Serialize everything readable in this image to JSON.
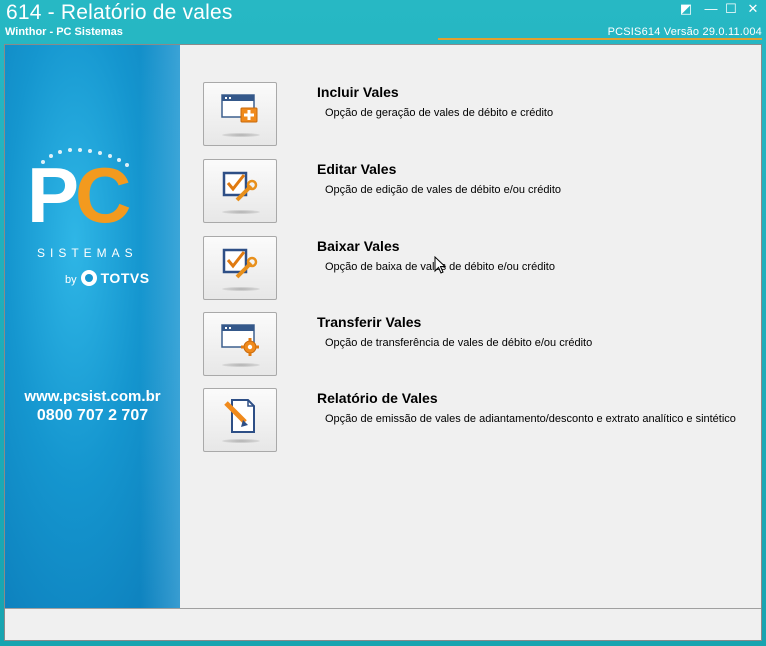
{
  "window": {
    "title": "614 - Relatório de vales",
    "subtitle": "Winthor - PC Sistemas",
    "version": "PCSIS614  Versão  29.0.11.004",
    "controls": {
      "resize": "◩",
      "minimize": "—",
      "maximize": "☐",
      "close": "✕"
    }
  },
  "brand": {
    "logo_p": "P",
    "logo_c": "C",
    "sistemas": "SISTEMAS",
    "by": "by",
    "totvs": "TOTVS",
    "website": "www.pcsist.com.br",
    "phone": "0800 707 2 707",
    "colors": {
      "primary": "#1596cf",
      "accent": "#f39a1e"
    }
  },
  "options": [
    {
      "title": "Incluir Vales",
      "description": "Opção de geração de vales de débito e crédito",
      "icon": "window-add-icon"
    },
    {
      "title": "Editar Vales",
      "description": "Opção de edição de vales de débito e/ou crédito",
      "icon": "checkbox-wrench-icon"
    },
    {
      "title": "Baixar Vales",
      "description": "Opção de baixa de vales de débito e/ou crédito",
      "icon": "checkbox-wrench-icon"
    },
    {
      "title": "Transferir Vales",
      "description": "Opção de transferência de vales de débito e/ou crédito",
      "icon": "window-gear-icon"
    },
    {
      "title": "Relatório de Vales",
      "description": "Opção de emissão de vales de adiantamento/desconto e extrato analítico e sintético",
      "icon": "document-pen-icon"
    }
  ]
}
